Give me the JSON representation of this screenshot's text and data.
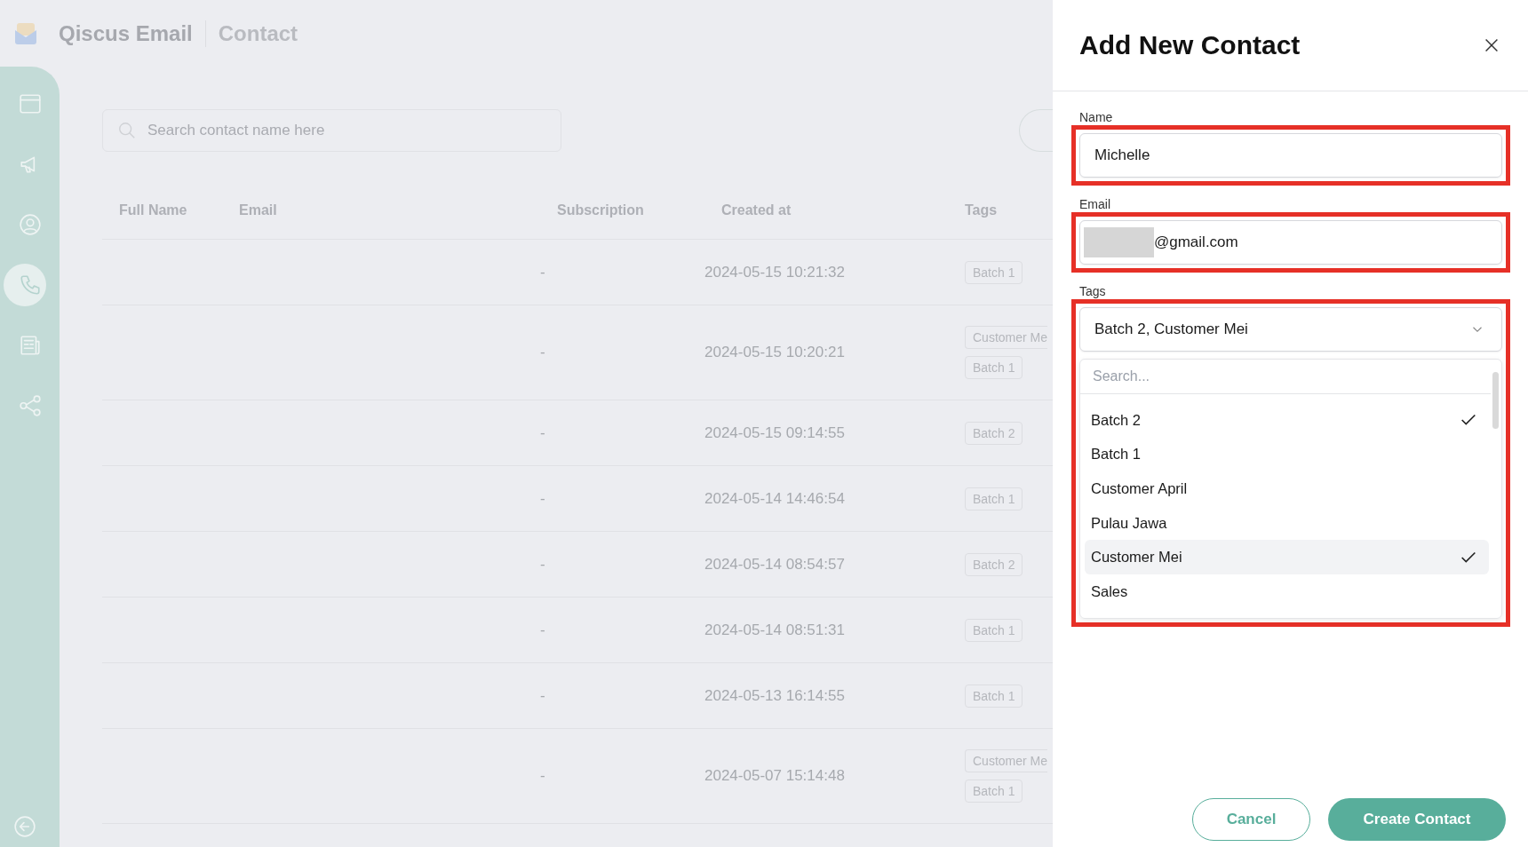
{
  "app": {
    "title": "Qiscus Email",
    "section": "Contact"
  },
  "nav": [
    {
      "kind": "browser",
      "selected": false
    },
    {
      "kind": "megaphone",
      "selected": false
    },
    {
      "kind": "user",
      "selected": false
    },
    {
      "kind": "phone",
      "selected": true
    },
    {
      "kind": "newspaper",
      "selected": false
    },
    {
      "kind": "share",
      "selected": false
    }
  ],
  "search": {
    "placeholder": "Search contact name here"
  },
  "table": {
    "columns": [
      "Full Name",
      "Email",
      "Subscription",
      "Created at",
      "Tags"
    ],
    "rows": [
      {
        "subscription": "-",
        "created_at": "2024-05-15 10:21:32",
        "tags": [
          {
            "label": "Batch 1",
            "clipped": false
          }
        ]
      },
      {
        "subscription": "-",
        "created_at": "2024-05-15 10:20:21",
        "tags": [
          {
            "label": "Customer Me",
            "clipped": true
          },
          {
            "label": "Batch 1",
            "clipped": false
          }
        ]
      },
      {
        "subscription": "-",
        "created_at": "2024-05-15 09:14:55",
        "tags": [
          {
            "label": "Batch 2",
            "clipped": false
          }
        ]
      },
      {
        "subscription": "-",
        "created_at": "2024-05-14 14:46:54",
        "tags": [
          {
            "label": "Batch 1",
            "clipped": false
          }
        ]
      },
      {
        "subscription": "-",
        "created_at": "2024-05-14 08:54:57",
        "tags": [
          {
            "label": "Batch 2",
            "clipped": false
          }
        ]
      },
      {
        "subscription": "-",
        "created_at": "2024-05-14 08:51:31",
        "tags": [
          {
            "label": "Batch 1",
            "clipped": false
          }
        ]
      },
      {
        "subscription": "-",
        "created_at": "2024-05-13 16:14:55",
        "tags": [
          {
            "label": "Batch 1",
            "clipped": false
          }
        ]
      },
      {
        "subscription": "-",
        "created_at": "2024-05-07 15:14:48",
        "tags": [
          {
            "label": "Customer Me",
            "clipped": true
          },
          {
            "label": "Batch 1",
            "clipped": false
          }
        ]
      }
    ]
  },
  "drawer": {
    "title": "Add New Contact",
    "name": {
      "label": "Name",
      "value": "Michelle",
      "highlighted": true
    },
    "email": {
      "label": "Email",
      "value": "@gmail.com",
      "redacted": true,
      "highlighted": true
    },
    "tags": {
      "label": "Tags",
      "value": "Batch 2, Customer Mei",
      "highlighted": true,
      "expanded": true,
      "search_placeholder": "Search...",
      "options": [
        {
          "label": "Batch 2",
          "selected": true,
          "hovered": false
        },
        {
          "label": "Batch 1",
          "selected": false,
          "hovered": false
        },
        {
          "label": "Customer April",
          "selected": false,
          "hovered": false
        },
        {
          "label": "Pulau Jawa",
          "selected": false,
          "hovered": false
        },
        {
          "label": "Customer Mei",
          "selected": true,
          "hovered": true
        },
        {
          "label": "Sales",
          "selected": false,
          "hovered": false
        }
      ]
    },
    "buttons": {
      "cancel": "Cancel",
      "submit": "Create Contact"
    }
  }
}
